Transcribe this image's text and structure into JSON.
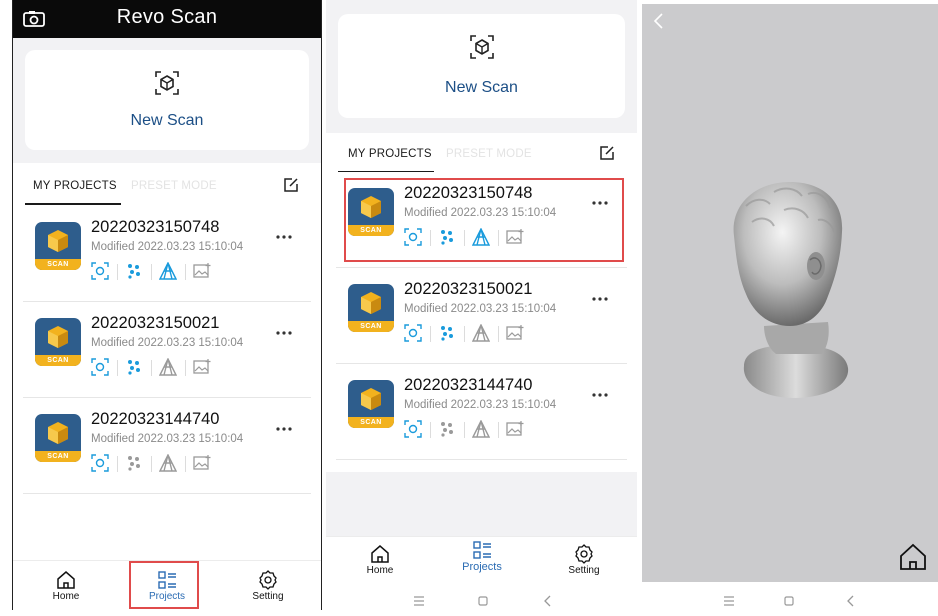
{
  "panel1": {
    "app_title": "Revo Scan",
    "new_scan_label": "New Scan",
    "tabs": {
      "active": "MY PROJECTS",
      "inactive": "PRESET MODE"
    },
    "projects": [
      {
        "name": "20220323150748",
        "modified": "Modified 2022.03.23 15:10:04",
        "tag": "SCAN"
      },
      {
        "name": "20220323150021",
        "modified": "Modified 2022.03.23 15:10:04",
        "tag": "SCAN"
      },
      {
        "name": "20220323144740",
        "modified": "Modified 2022.03.23 15:10:04",
        "tag": "SCAN"
      }
    ],
    "nav": [
      {
        "label": "Home"
      },
      {
        "label": "Projects"
      },
      {
        "label": "Setting"
      }
    ]
  },
  "panel2": {
    "new_scan_label": "New Scan",
    "tabs": {
      "active": "MY PROJECTS",
      "inactive": "PRESET MODE"
    },
    "projects": [
      {
        "name": "20220323150748",
        "modified": "Modified 2022.03.23 15:10:04",
        "tag": "SCAN"
      },
      {
        "name": "20220323150021",
        "modified": "Modified 2022.03.23 15:10:04",
        "tag": "SCAN"
      },
      {
        "name": "20220323144740",
        "modified": "Modified 2022.03.23 15:10:04",
        "tag": "SCAN"
      }
    ],
    "nav": [
      {
        "label": "Home"
      },
      {
        "label": "Projects"
      },
      {
        "label": "Setting"
      }
    ]
  },
  "colors": {
    "accent_blue": "#2a6bb3",
    "highlight_red": "#e04b4b",
    "thumb_blue": "#2e5d8c",
    "tag_yellow": "#f2b21e",
    "icon_cyan": "#1a9bdc",
    "icon_gray": "#9a9a9a",
    "viewer_bg": "#cbcbcd"
  },
  "icons": {
    "action_states_row": [
      "active",
      "active",
      "active",
      "inactive"
    ]
  }
}
